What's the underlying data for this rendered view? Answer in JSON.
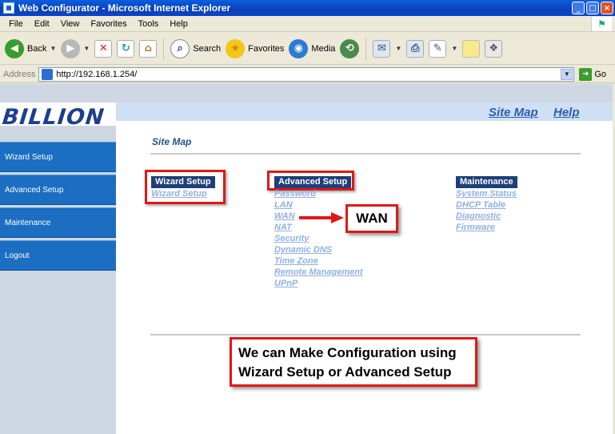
{
  "window": {
    "title": "Web Configurator - Microsoft Internet Explorer"
  },
  "menu": [
    "File",
    "Edit",
    "View",
    "Favorites",
    "Tools",
    "Help"
  ],
  "toolbar": {
    "back": "Back",
    "search": "Search",
    "favorites": "Favorites",
    "media": "Media"
  },
  "address": {
    "label": "Address",
    "url": "http://192.168.1.254/",
    "go": "Go"
  },
  "brand": {
    "logo": "BILLION"
  },
  "header": {
    "site_map": "Site Map",
    "help": "Help"
  },
  "sidebar": {
    "items": [
      "Wizard Setup",
      "Advanced Setup",
      "Maintenance",
      "Logout"
    ]
  },
  "content": {
    "title": "Site Map",
    "columns": [
      {
        "heading": "Wizard Setup",
        "links": [
          "Wizard Setup"
        ]
      },
      {
        "heading": "Advanced Setup",
        "links": [
          "Password",
          "LAN",
          "WAN",
          "NAT",
          "Security",
          "Dynamic DNS",
          "Time Zone",
          "Remote Management",
          "UPnP"
        ]
      },
      {
        "heading": "Maintenance",
        "links": [
          "System Status",
          "DHCP Table",
          "Diagnostic",
          "Firmware"
        ]
      }
    ]
  },
  "annotations": {
    "wan": "WAN",
    "note_line1": "We can Make Configuration using",
    "note_line2": "Wizard Setup or Advanced Setup"
  },
  "colors": {
    "sidebar_item": "#1b6ec2",
    "column_heading": "#1e3f77",
    "highlight": "#e01818",
    "logo": "#1d3f8c"
  }
}
